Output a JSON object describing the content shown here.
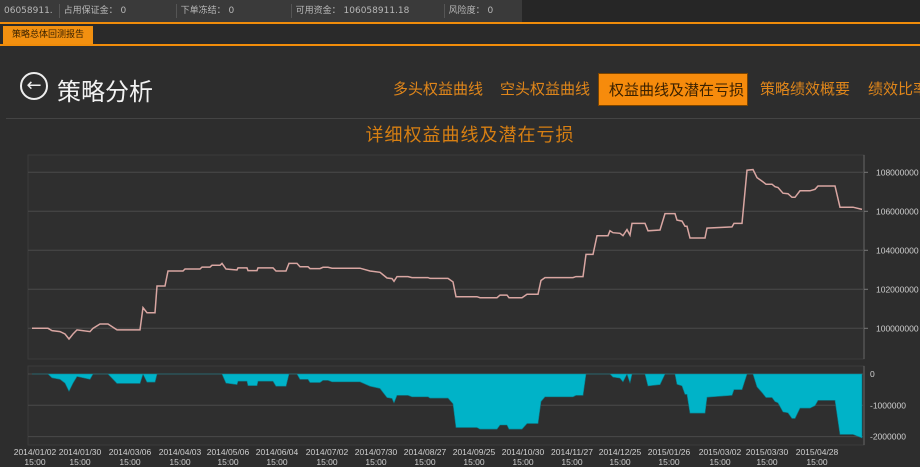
{
  "status_bar": {
    "items": [
      "06058911.",
      "占用保证金： 0",
      "下单冻结： 0",
      "可用资金： 106058911.18",
      "风险度： 0"
    ]
  },
  "main_tab": "策略总体回测报告",
  "header": {
    "title": "策略分析",
    "back_icon": "back-arrow-circle-icon"
  },
  "nav_tabs": [
    {
      "label": "多头权益曲线",
      "active": false
    },
    {
      "label": "空头权益曲线",
      "active": false
    },
    {
      "label": "权益曲线及潜在亏损",
      "active": true
    },
    {
      "label": "策略绩效概要",
      "active": false
    },
    {
      "label": "绩效比率",
      "active": false
    }
  ],
  "colors": {
    "accent": "#f68b0c",
    "equity_line": "#d9a6a2",
    "drawdown_fill": "#00b3c8"
  },
  "chart_data": {
    "type": "line",
    "title": "详细权益曲线及潜在亏损",
    "x_unit": "time index (dates on axis)",
    "xlim": [
      0,
      834
    ],
    "x_tick_labels": [
      {
        "t": 5,
        "date": "2014/01/02",
        "time": "15:00"
      },
      {
        "t": 50,
        "date": "2014/01/30",
        "time": "15:00"
      },
      {
        "t": 100,
        "date": "2014/03/06",
        "time": "15:00"
      },
      {
        "t": 150,
        "date": "2014/04/03",
        "time": "15:00"
      },
      {
        "t": 198,
        "date": "2014/05/06",
        "time": "15:00"
      },
      {
        "t": 247,
        "date": "2014/06/04",
        "time": "15:00"
      },
      {
        "t": 297,
        "date": "2014/07/02",
        "time": "15:00"
      },
      {
        "t": 346,
        "date": "2014/07/30",
        "time": "15:00"
      },
      {
        "t": 395,
        "date": "2014/08/27",
        "time": "15:00"
      },
      {
        "t": 444,
        "date": "2014/09/25",
        "time": "15:00"
      },
      {
        "t": 493,
        "date": "2014/10/30",
        "time": "15:00"
      },
      {
        "t": 542,
        "date": "2014/11/27",
        "time": "15:00"
      },
      {
        "t": 590,
        "date": "2014/12/25",
        "time": "15:00"
      },
      {
        "t": 639,
        "date": "2015/01/26",
        "time": "15:00"
      },
      {
        "t": 690,
        "date": "2015/03/02",
        "time": "15:00"
      },
      {
        "t": 737,
        "date": "2015/03/30",
        "time": "15:00"
      },
      {
        "t": 787,
        "date": "2015/04/28",
        "time": "15:00"
      }
    ],
    "equity": {
      "name": "权益",
      "ylim_millions": [
        98.5,
        108.9
      ],
      "y_ticks": [
        "100000000",
        "102000000",
        "104000000",
        "106000000",
        "108000000"
      ],
      "y_tick_values_millions": [
        100,
        102,
        104,
        106,
        108
      ],
      "value_unit": "millions",
      "points": [
        [
          2,
          100.0
        ],
        [
          18,
          100.0
        ],
        [
          22,
          99.88
        ],
        [
          30,
          99.83
        ],
        [
          35,
          99.71
        ],
        [
          39,
          99.45
        ],
        [
          43,
          99.71
        ],
        [
          47,
          99.92
        ],
        [
          60,
          99.83
        ],
        [
          63,
          100.0
        ],
        [
          70,
          100.22
        ],
        [
          78,
          100.22
        ],
        [
          87,
          99.92
        ],
        [
          110,
          99.92
        ],
        [
          113,
          101.06
        ],
        [
          117,
          100.8
        ],
        [
          125,
          100.8
        ],
        [
          127,
          102.17
        ],
        [
          135,
          102.17
        ],
        [
          138,
          102.94
        ],
        [
          153,
          102.94
        ],
        [
          155,
          103.04
        ],
        [
          170,
          103.04
        ],
        [
          172,
          103.14
        ],
        [
          180,
          103.14
        ],
        [
          182,
          103.23
        ],
        [
          190,
          103.23
        ],
        [
          192,
          103.33
        ],
        [
          196,
          103.04
        ],
        [
          207,
          102.99
        ],
        [
          208,
          103.1
        ],
        [
          217,
          103.1
        ],
        [
          218,
          102.96
        ],
        [
          227,
          102.96
        ],
        [
          228,
          103.1
        ],
        [
          243,
          103.1
        ],
        [
          246,
          102.94
        ],
        [
          256,
          102.94
        ],
        [
          259,
          103.33
        ],
        [
          267,
          103.33
        ],
        [
          270,
          103.16
        ],
        [
          278,
          103.16
        ],
        [
          280,
          103.06
        ],
        [
          290,
          103.06
        ],
        [
          293,
          103.13
        ],
        [
          298,
          103.13
        ],
        [
          302,
          103.08
        ],
        [
          330,
          103.08
        ],
        [
          340,
          102.94
        ],
        [
          350,
          102.87
        ],
        [
          357,
          102.58
        ],
        [
          362,
          102.55
        ],
        [
          364,
          102.41
        ],
        [
          367,
          102.65
        ],
        [
          378,
          102.65
        ],
        [
          382,
          102.6
        ],
        [
          398,
          102.6
        ],
        [
          400,
          102.56
        ],
        [
          418,
          102.56
        ],
        [
          423,
          102.38
        ],
        [
          426,
          101.62
        ],
        [
          447,
          101.62
        ],
        [
          450,
          101.57
        ],
        [
          467,
          101.57
        ],
        [
          470,
          101.7
        ],
        [
          477,
          101.7
        ],
        [
          479,
          101.57
        ],
        [
          492,
          101.57
        ],
        [
          497,
          101.75
        ],
        [
          508,
          101.75
        ],
        [
          511,
          102.45
        ],
        [
          515,
          102.6
        ],
        [
          543,
          102.6
        ],
        [
          546,
          102.65
        ],
        [
          553,
          102.65
        ],
        [
          556,
          103.79
        ],
        [
          563,
          103.79
        ],
        [
          567,
          104.75
        ],
        [
          578,
          104.75
        ],
        [
          580,
          105.0
        ],
        [
          583,
          104.9
        ],
        [
          590,
          104.87
        ],
        [
          593,
          104.75
        ],
        [
          597,
          105.06
        ],
        [
          600,
          104.78
        ],
        [
          602,
          105.38
        ],
        [
          615,
          105.38
        ],
        [
          618,
          105.0
        ],
        [
          630,
          105.04
        ],
        [
          635,
          105.88
        ],
        [
          645,
          105.88
        ],
        [
          647,
          105.55
        ],
        [
          652,
          105.5
        ],
        [
          655,
          105.23
        ],
        [
          657,
          105.23
        ],
        [
          660,
          104.63
        ],
        [
          675,
          104.63
        ],
        [
          677,
          105.14
        ],
        [
          702,
          105.2
        ],
        [
          704,
          105.38
        ],
        [
          712,
          105.38
        ],
        [
          717,
          108.11
        ],
        [
          723,
          108.14
        ],
        [
          727,
          107.73
        ],
        [
          732,
          107.55
        ],
        [
          736,
          107.39
        ],
        [
          742,
          107.39
        ],
        [
          745,
          107.26
        ],
        [
          748,
          107.22
        ],
        [
          753,
          106.93
        ],
        [
          758,
          106.9
        ],
        [
          762,
          106.72
        ],
        [
          765,
          106.72
        ],
        [
          770,
          107.05
        ],
        [
          780,
          107.05
        ],
        [
          785,
          107.13
        ],
        [
          788,
          107.3
        ],
        [
          805,
          107.3
        ],
        [
          810,
          106.21
        ],
        [
          823,
          106.21
        ],
        [
          832,
          106.1
        ]
      ]
    },
    "drawdown": {
      "name": "潜在亏损",
      "type": "area",
      "derived_from": "equity running-max drawdown",
      "ylim": [
        -2200000,
        200000
      ],
      "y_ticks": [
        "0",
        "-1000000",
        "-2000000"
      ],
      "y_tick_values": [
        0,
        -1000000,
        -2000000
      ]
    }
  }
}
